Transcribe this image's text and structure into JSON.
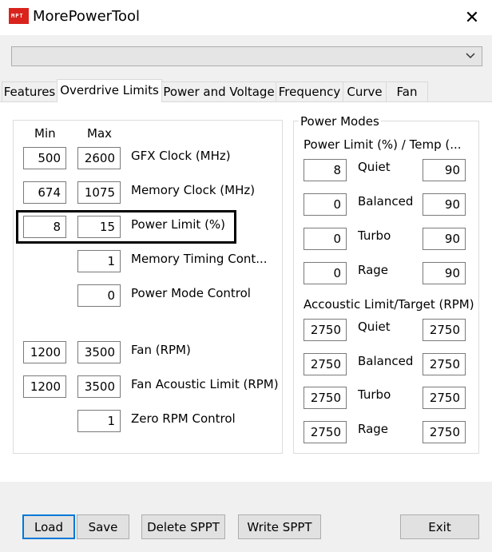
{
  "window": {
    "title": "MorePowerTool",
    "icon_text": "MPT",
    "close_glyph": "✕"
  },
  "combo": {
    "value": "",
    "arrow_glyph": "⌄"
  },
  "tabs": [
    "Features",
    "Overdrive Limits",
    "Power and Voltage",
    "Frequency",
    "Curve",
    "Fan"
  ],
  "overdrive": {
    "min_header": "Min",
    "max_header": "Max",
    "rows": [
      {
        "min": "500",
        "max": "2600",
        "label": "GFX Clock (MHz)"
      },
      {
        "min": "674",
        "max": "1075",
        "label": "Memory Clock (MHz)"
      },
      {
        "min": "8",
        "max": "15",
        "label": "Power Limit (%)"
      },
      {
        "min": "",
        "max": "1",
        "label": "Memory Timing Cont..."
      },
      {
        "min": "",
        "max": "0",
        "label": "Power Mode Control"
      },
      {
        "min": "1200",
        "max": "3500",
        "label": "Fan (RPM)"
      },
      {
        "min": "1200",
        "max": "3500",
        "label": "Fan Acoustic Limit (RPM)"
      },
      {
        "min": "",
        "max": "1",
        "label": "Zero RPM Control"
      }
    ]
  },
  "power_modes": {
    "group_title": "Power Modes",
    "power_limit_header": "Power Limit (%) / Temp (...",
    "power_limit_rows": [
      {
        "left": "8",
        "label": "Quiet",
        "right": "90"
      },
      {
        "left": "0",
        "label": "Balanced",
        "right": "90"
      },
      {
        "left": "0",
        "label": "Turbo",
        "right": "90"
      },
      {
        "left": "0",
        "label": "Rage",
        "right": "90"
      }
    ],
    "acoustic_header": "Accoustic Limit/Target (RPM)",
    "acoustic_rows": [
      {
        "left": "2750",
        "label": "Quiet",
        "right": "2750"
      },
      {
        "left": "2750",
        "label": "Balanced",
        "right": "2750"
      },
      {
        "left": "2750",
        "label": "Turbo",
        "right": "2750"
      },
      {
        "left": "2750",
        "label": "Rage",
        "right": "2750"
      }
    ]
  },
  "buttons": {
    "load": "Load",
    "save": "Save",
    "delete_sppt": "Delete SPPT",
    "write_sppt": "Write SPPT",
    "exit": "Exit"
  }
}
